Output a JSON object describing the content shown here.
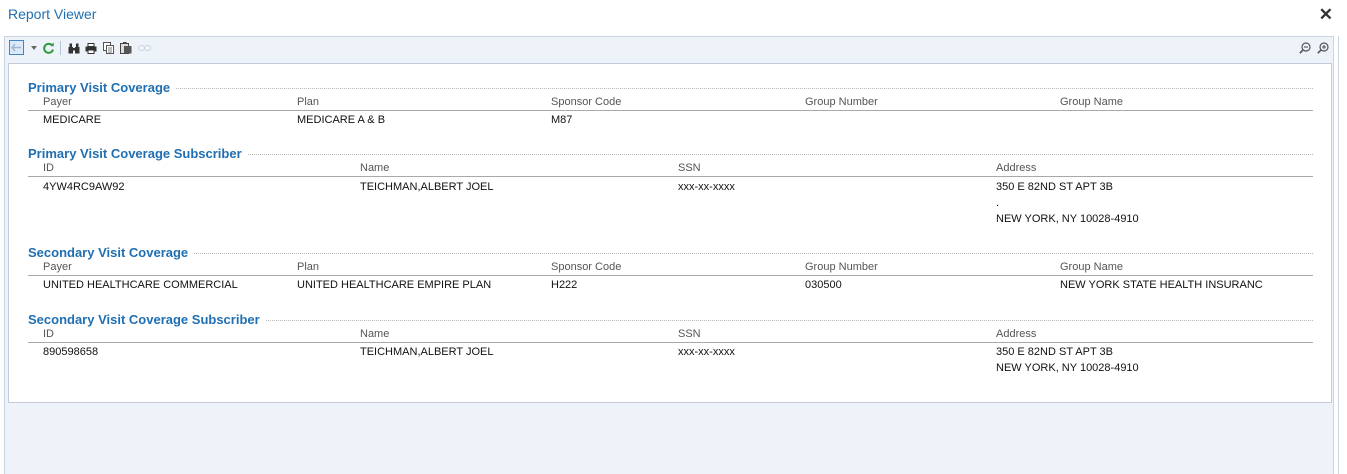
{
  "window": {
    "title": "Report Viewer"
  },
  "toolbar": {
    "icons": [
      "back-icon",
      "dropdown-arrow-icon",
      "refresh-icon",
      "find-icon",
      "print-icon",
      "copy-icon",
      "export-icon",
      "link-icon",
      "zoom-out-icon",
      "zoom-in-icon"
    ]
  },
  "primary_coverage": {
    "title": "Primary Visit Coverage",
    "headers": [
      "Payer",
      "Plan",
      "Sponsor Code",
      "Group Number",
      "Group Name"
    ],
    "values": [
      "MEDICARE",
      "MEDICARE A & B",
      "M87",
      "",
      ""
    ]
  },
  "primary_subscriber": {
    "title": "Primary Visit Coverage Subscriber",
    "headers": [
      "ID",
      "Name",
      "SSN",
      "Address"
    ],
    "id": "4YW4RC9AW92",
    "name": "TEICHMAN,ALBERT JOEL",
    "ssn": "xxx-xx-xxxx",
    "address": [
      "350 E 82ND ST APT 3B",
      ".",
      "NEW YORK, NY 10028-4910"
    ]
  },
  "secondary_coverage": {
    "title": "Secondary Visit Coverage",
    "headers": [
      "Payer",
      "Plan",
      "Sponsor Code",
      "Group Number",
      "Group Name"
    ],
    "values": [
      "UNITED HEALTHCARE COMMERCIAL",
      "UNITED HEALTHCARE EMPIRE PLAN",
      "H222",
      "030500",
      "NEW YORK STATE HEALTH INSURANC"
    ]
  },
  "secondary_subscriber": {
    "title": "Secondary Visit Coverage Subscriber",
    "headers": [
      "ID",
      "Name",
      "SSN",
      "Address"
    ],
    "id": "890598658",
    "name": "TEICHMAN,ALBERT JOEL",
    "ssn": "xxx-xx-xxxx",
    "address": [
      "350 E 82ND ST APT 3B",
      "NEW YORK, NY 10028-4910"
    ]
  },
  "colors": {
    "accent": "#1f6fb2",
    "viewer_bg": "#eef3fa",
    "border": "#c3ccd8"
  }
}
